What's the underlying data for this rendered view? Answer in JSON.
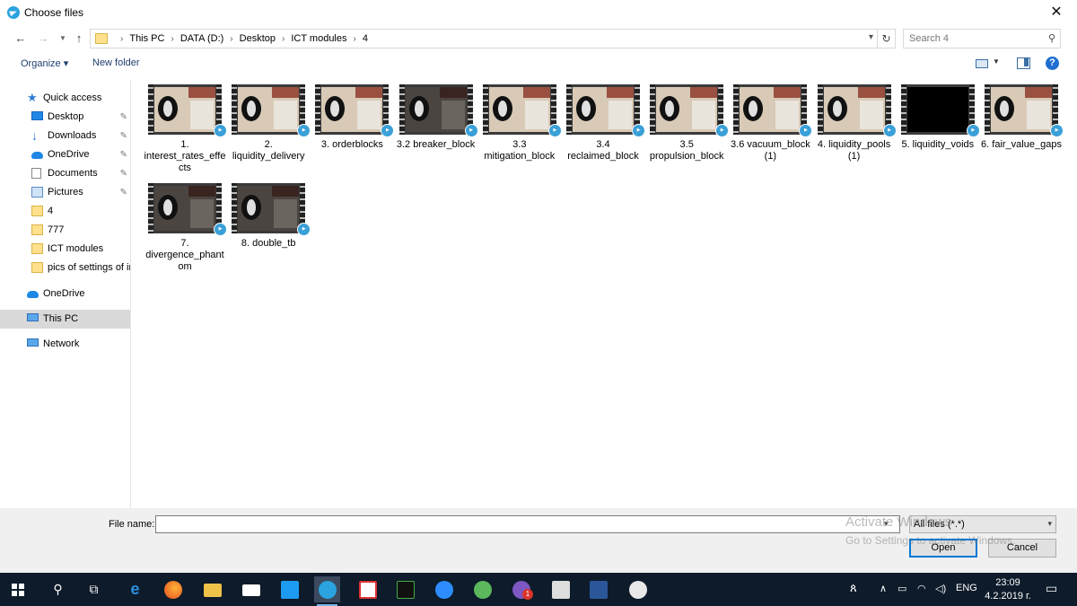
{
  "window": {
    "title": "Choose files",
    "close_label": "✕"
  },
  "address": {
    "crumbs": [
      "This PC",
      "DATA (D:)",
      "Desktop",
      "ICT modules",
      "4"
    ],
    "search_placeholder": "Search 4"
  },
  "toolbar": {
    "organize_label": "Organize ▾",
    "new_folder_label": "New folder",
    "help_label": "?"
  },
  "sidebar": {
    "items": [
      {
        "label": "Quick access",
        "icon": "star-icon",
        "pinned": false
      },
      {
        "label": "Desktop",
        "icon": "desktop-icon",
        "pinned": true
      },
      {
        "label": "Downloads",
        "icon": "download-icon",
        "pinned": true
      },
      {
        "label": "OneDrive",
        "icon": "onedrive-icon",
        "pinned": true
      },
      {
        "label": "Documents",
        "icon": "documents-icon",
        "pinned": true
      },
      {
        "label": "Pictures",
        "icon": "pictures-icon",
        "pinned": true
      },
      {
        "label": "4",
        "icon": "folder-icon",
        "pinned": false
      },
      {
        "label": "777",
        "icon": "folder-icon",
        "pinned": false
      },
      {
        "label": "ICT modules",
        "icon": "folder-icon",
        "pinned": false
      },
      {
        "label": "pics of settings of ir",
        "icon": "folder-icon",
        "pinned": false
      },
      {
        "label": "OneDrive",
        "icon": "onedrive-icon",
        "pinned": false
      },
      {
        "label": "This PC",
        "icon": "this-pc-icon",
        "pinned": false,
        "selected": true
      },
      {
        "label": "Network",
        "icon": "network-icon",
        "pinned": false
      }
    ]
  },
  "files": [
    {
      "name": "1. interest_rates_effects",
      "style": "light"
    },
    {
      "name": "2. liquidity_delivery",
      "style": "light"
    },
    {
      "name": "3. orderblocks",
      "style": "light"
    },
    {
      "name": "3.2 breaker_block",
      "style": "dark"
    },
    {
      "name": "3.3 mitigation_block",
      "style": "light"
    },
    {
      "name": "3.4 reclaimed_block",
      "style": "light"
    },
    {
      "name": "3.5 propulsion_block",
      "style": "light"
    },
    {
      "name": "3.6 vacuum_block (1)",
      "style": "light"
    },
    {
      "name": "4. liquidity_pools (1)",
      "style": "light"
    },
    {
      "name": "5. liquidity_voids",
      "style": "black"
    },
    {
      "name": "6. fair_value_gaps",
      "style": "light"
    },
    {
      "name": "7. divergence_phantom",
      "style": "dark"
    },
    {
      "name": "8. double_tb",
      "style": "dark"
    }
  ],
  "bottom": {
    "file_name_label": "File name:",
    "file_name_value": "",
    "filter_label": "All files (*.*)",
    "open_label": "Open",
    "cancel_label": "Cancel",
    "watermark_line1": "Activate Windows",
    "watermark_line2": "Go to Settings to activate Windows."
  },
  "taskbar": {
    "language": "ENG",
    "time": "23:09",
    "date": "4.2.2019 г.",
    "notification_count": "1"
  },
  "colors": {
    "accent": "#0078d7",
    "taskbar": "#0d1b2a",
    "selected_nav": "#d9d9d9"
  }
}
